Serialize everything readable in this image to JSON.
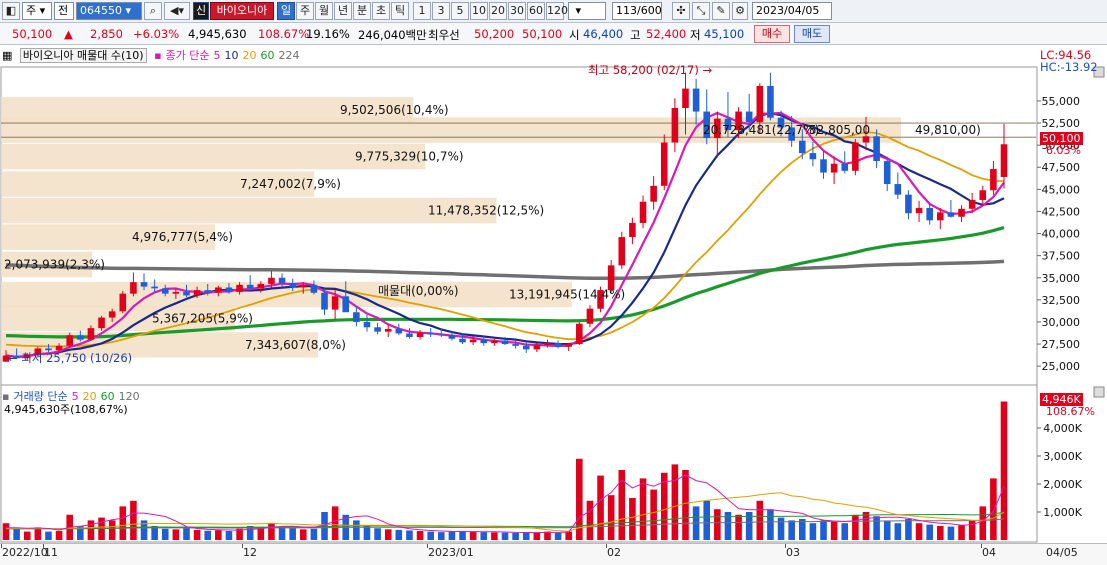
{
  "toolbar": {
    "market": "주",
    "exchange": "전",
    "code": "064550",
    "badge": "신",
    "stock_name": "바이오니아",
    "periods": [
      "일",
      "주",
      "월",
      "년",
      "분",
      "초",
      "틱"
    ],
    "intervals": [
      "1",
      "3",
      "5",
      "10",
      "20",
      "30",
      "60",
      "120"
    ],
    "count": "113/600",
    "date": "2023/04/05"
  },
  "quote": {
    "price": "50,100",
    "arrow": "▲",
    "change": "2,850",
    "change_pct": "+6.03%",
    "volume": "4,945,630",
    "volume_ratio": "108.67%",
    "turnover": "19.16%",
    "amount": "246,040백만",
    "best_label": "최우선",
    "best_ask": "50,200",
    "best_bid": "50,100",
    "open_label": "시",
    "open": "46,400",
    "high_label": "고",
    "high": "52,400",
    "low_label": "저",
    "low": "45,100",
    "buy": "매수",
    "sell": "매도"
  },
  "price_legend": {
    "title": "바이오니아 매물대 수(10)",
    "ma_label": "종가 단순",
    "ma": [
      "5",
      "10",
      "20",
      "60",
      "224"
    ],
    "lc": "LC:94.56",
    "hc": "HC:-13.92"
  },
  "volume_legend": {
    "label": "거래량 단순",
    "ma": [
      "5",
      "20",
      "60",
      "120"
    ],
    "summary": "4,945,630주(108,67%)"
  },
  "annotations": {
    "high": "최고 58,200 (02/17)",
    "low": "최저 25,750 (10/26)",
    "last_tag": "50,100",
    "last_pct": "6.03%",
    "vol_tag": "4,946K",
    "vol_pct": "108.67%"
  },
  "price_axis": [
    "55,000",
    "52,500",
    "50,000",
    "47,500",
    "45,000",
    "42,500",
    "40,000",
    "37,500",
    "35,000",
    "32,500",
    "30,000",
    "27,500",
    "25,000"
  ],
  "volume_axis": [
    "4,000K",
    "3,000K",
    "2,000K",
    "1,000K"
  ],
  "date_axis": [
    "2022/10",
    "11",
    "12",
    "2023/01",
    "02",
    "03",
    "04",
    "04/05"
  ],
  "colors": {
    "up": "#e0001b",
    "down": "#1f5fd6",
    "ma5": "#d81ab8",
    "ma10": "#1a2a8a",
    "ma20": "#e0a000",
    "ma60": "#1a9a2a",
    "ma224": "#707070",
    "profile": "#f3dfc4"
  },
  "chart_data": {
    "type": "candlestick",
    "y_range": [
      24000,
      58500
    ],
    "volume_range_k": [
      0,
      5000
    ],
    "volume_profile": [
      {
        "label": "9,502,506(10,4%)",
        "price": 54000,
        "pct": 10.4
      },
      {
        "label": "20,728,481(22,7%)",
        "price": 51700,
        "pct": 22.7
      },
      {
        "label": "52,805,00",
        "price": 51700,
        "pct": 0
      },
      {
        "label": "49,810,00)",
        "price": 51700,
        "pct": 0
      },
      {
        "label": "9,775,329(10,7%)",
        "price": 48700,
        "pct": 10.7
      },
      {
        "label": "7,247,002(7,9%)",
        "price": 45600,
        "pct": 7.9
      },
      {
        "label": "11,478,352(12,5%)",
        "price": 42600,
        "pct": 12.5
      },
      {
        "label": "4,976,777(5,4%)",
        "price": 39600,
        "pct": 5.4
      },
      {
        "label": "2,073,939(2,3%)",
        "price": 36500,
        "pct": 2.3
      },
      {
        "label": "매물대(0,00%)",
        "price": 33500,
        "pct": 0.0
      },
      {
        "label": "13,191,945(14,4%)",
        "price": 33100,
        "pct": 14.4
      },
      {
        "label": "5,367,205(5,9%)",
        "price": 30400,
        "pct": 5.9
      },
      {
        "label": "7,343,607(8,0%)",
        "price": 27400,
        "pct": 8.0
      }
    ],
    "candles": [
      [
        25500,
        26800,
        25750,
        26200,
        600
      ],
      [
        26200,
        27000,
        25800,
        25900,
        400
      ],
      [
        25900,
        26500,
        25600,
        26300,
        300
      ],
      [
        26300,
        27200,
        26000,
        27000,
        450
      ],
      [
        27000,
        27500,
        26600,
        26800,
        300
      ],
      [
        26800,
        27600,
        26500,
        27300,
        320
      ],
      [
        27300,
        28800,
        27100,
        28500,
        900
      ],
      [
        28500,
        29000,
        27800,
        28000,
        500
      ],
      [
        28000,
        29600,
        27900,
        29300,
        700
      ],
      [
        29300,
        30700,
        29000,
        30500,
        800
      ],
      [
        30500,
        31500,
        30000,
        31200,
        700
      ],
      [
        31200,
        33500,
        31000,
        33200,
        1200
      ],
      [
        33200,
        35600,
        32900,
        34500,
        1400
      ],
      [
        34500,
        35500,
        33600,
        34000,
        700
      ],
      [
        34000,
        34800,
        33300,
        33800,
        500
      ],
      [
        33800,
        34200,
        32900,
        33200,
        400
      ],
      [
        33200,
        33800,
        32600,
        33400,
        380
      ],
      [
        33400,
        34200,
        32800,
        33000,
        420
      ],
      [
        33000,
        34000,
        32700,
        33600,
        360
      ],
      [
        33600,
        34300,
        33000,
        33300,
        330
      ],
      [
        33300,
        34100,
        32900,
        33900,
        350
      ],
      [
        33900,
        34400,
        33200,
        33400,
        320
      ],
      [
        33400,
        34500,
        33100,
        34200,
        400
      ],
      [
        34200,
        35300,
        33600,
        33800,
        500
      ],
      [
        33800,
        34600,
        33300,
        34300,
        450
      ],
      [
        34300,
        35800,
        33900,
        35000,
        600
      ],
      [
        35000,
        35500,
        33900,
        34400,
        480
      ],
      [
        34400,
        34900,
        33500,
        33900,
        420
      ],
      [
        33900,
        34500,
        33200,
        34200,
        380
      ],
      [
        34200,
        34700,
        33100,
        33300,
        400
      ],
      [
        33300,
        33800,
        30800,
        31400,
        1000
      ],
      [
        31400,
        33600,
        30300,
        32900,
        1200
      ],
      [
        32900,
        34600,
        32100,
        31100,
        900
      ],
      [
        31100,
        31800,
        29500,
        30000,
        700
      ],
      [
        30000,
        30800,
        28900,
        29400,
        500
      ],
      [
        29400,
        29900,
        28600,
        28900,
        420
      ],
      [
        28900,
        29700,
        28300,
        29200,
        380
      ],
      [
        29200,
        29800,
        28500,
        28700,
        360
      ],
      [
        28700,
        29300,
        28100,
        28300,
        340
      ],
      [
        28300,
        29100,
        28000,
        28800,
        320
      ],
      [
        28800,
        29300,
        28300,
        28600,
        300
      ],
      [
        28600,
        29200,
        28300,
        28500,
        280
      ],
      [
        28500,
        28900,
        27900,
        28100,
        300
      ],
      [
        28100,
        28700,
        27500,
        27700,
        320
      ],
      [
        27700,
        28400,
        27400,
        28000,
        300
      ],
      [
        28000,
        28400,
        27300,
        27600,
        280
      ],
      [
        27600,
        28200,
        27300,
        27900,
        270
      ],
      [
        27900,
        28300,
        27400,
        27500,
        260
      ],
      [
        27500,
        28000,
        27000,
        27300,
        250
      ],
      [
        27300,
        27700,
        26500,
        26900,
        280
      ],
      [
        26900,
        27600,
        26600,
        27400,
        270
      ],
      [
        27400,
        28000,
        27100,
        27600,
        300
      ],
      [
        27600,
        27900,
        27000,
        27200,
        260
      ],
      [
        27200,
        27600,
        26700,
        27500,
        300
      ],
      [
        27500,
        30000,
        27400,
        29800,
        2900
      ],
      [
        29800,
        31900,
        29400,
        31500,
        1400
      ],
      [
        31500,
        34000,
        31100,
        33600,
        2300
      ],
      [
        33600,
        37000,
        33300,
        36400,
        1600
      ],
      [
        36400,
        40200,
        36000,
        39600,
        2500
      ],
      [
        39600,
        41800,
        38800,
        41200,
        1500
      ],
      [
        41200,
        44300,
        40600,
        43600,
        2200
      ],
      [
        43600,
        46500,
        42700,
        45400,
        1800
      ],
      [
        45400,
        51200,
        44900,
        50300,
        2400
      ],
      [
        50300,
        55300,
        49200,
        54200,
        2700
      ],
      [
        54200,
        58200,
        51200,
        56400,
        2500
      ],
      [
        56400,
        57500,
        52300,
        53800,
        1200
      ],
      [
        53800,
        56300,
        50100,
        50800,
        1400
      ],
      [
        50800,
        53800,
        48600,
        53000,
        1100
      ],
      [
        53000,
        56000,
        50900,
        51700,
        1000
      ],
      [
        51700,
        54300,
        50800,
        53800,
        900
      ],
      [
        53800,
        55800,
        51700,
        52600,
        1000
      ],
      [
        52600,
        57000,
        51300,
        56700,
        1400
      ],
      [
        56700,
        58200,
        52800,
        53100,
        1100
      ],
      [
        53100,
        53900,
        51000,
        52000,
        800
      ],
      [
        52000,
        53300,
        49800,
        50500,
        700
      ],
      [
        50500,
        51800,
        48400,
        49100,
        750
      ],
      [
        49100,
        50400,
        47600,
        48400,
        600
      ],
      [
        48400,
        49400,
        46200,
        46900,
        700
      ],
      [
        46900,
        48700,
        45600,
        47900,
        650
      ],
      [
        47900,
        49300,
        46800,
        47100,
        600
      ],
      [
        47100,
        50700,
        46600,
        50300,
        900
      ],
      [
        50300,
        53200,
        49400,
        51000,
        1000
      ],
      [
        51000,
        51800,
        47400,
        48200,
        850
      ],
      [
        48200,
        48700,
        44800,
        45600,
        700
      ],
      [
        45600,
        46900,
        43900,
        44400,
        600
      ],
      [
        44400,
        44900,
        41600,
        42300,
        750
      ],
      [
        42300,
        43700,
        41300,
        42900,
        600
      ],
      [
        42900,
        43400,
        41000,
        41500,
        550
      ],
      [
        41500,
        42900,
        40500,
        42400,
        500
      ],
      [
        42400,
        43800,
        41800,
        41900,
        480
      ],
      [
        41900,
        43200,
        41300,
        42800,
        520
      ],
      [
        42800,
        44600,
        42300,
        43800,
        700
      ],
      [
        43800,
        45400,
        43200,
        44900,
        1200
      ],
      [
        44900,
        48200,
        44400,
        47300,
        2200
      ],
      [
        46400,
        52400,
        45100,
        50100,
        4946
      ]
    ],
    "series": [
      {
        "name": "5"
      },
      {
        "name": "10"
      },
      {
        "name": "20"
      },
      {
        "name": "60"
      },
      {
        "name": "224"
      }
    ]
  }
}
